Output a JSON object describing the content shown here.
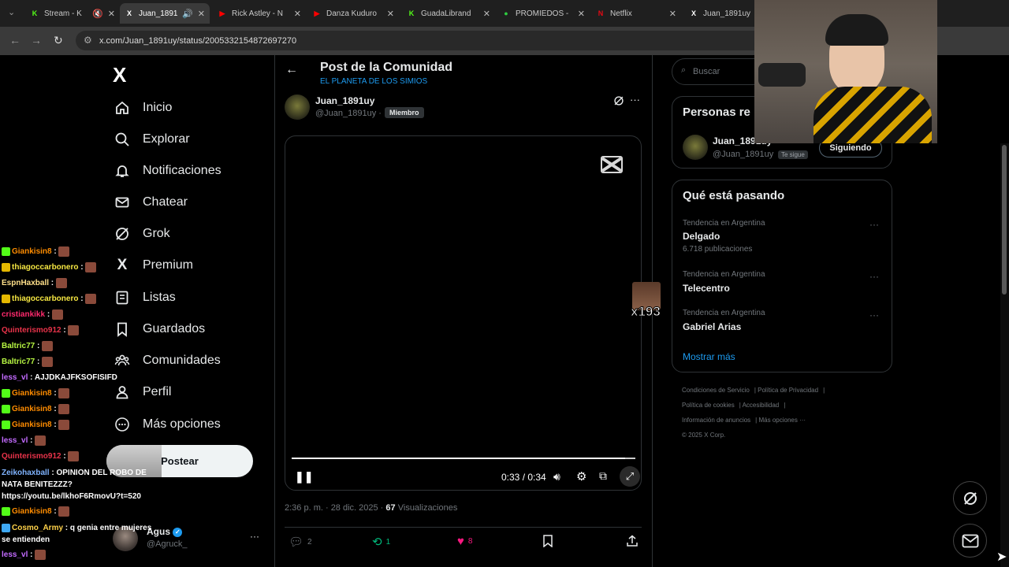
{
  "browser": {
    "tabs": [
      {
        "title": "Stream - K",
        "fav": "K",
        "favcolor": "#53fc18"
      },
      {
        "title": "Juan_1891",
        "fav": "X",
        "favcolor": "#ffffff"
      },
      {
        "title": "Rick Astley - N",
        "fav": "▶",
        "favcolor": "#ff0000"
      },
      {
        "title": "Danza Kuduro",
        "fav": "▶",
        "favcolor": "#ff0000"
      },
      {
        "title": "GuadaLibrand",
        "fav": "K",
        "favcolor": "#53fc18"
      },
      {
        "title": "PROMIEDOS -",
        "fav": "●",
        "favcolor": "#2ecc40"
      },
      {
        "title": "Netflix",
        "fav": "N",
        "favcolor": "#e50914"
      },
      {
        "title": "Juan_1891uy",
        "fav": "X",
        "favcolor": "#ffffff"
      }
    ],
    "url": "x.com/Juan_1891uy/status/2005332154872697270"
  },
  "sidebar": {
    "logo": "X",
    "items": [
      {
        "label": "Inicio"
      },
      {
        "label": "Explorar"
      },
      {
        "label": "Notificaciones"
      },
      {
        "label": "Chatear"
      },
      {
        "label": "Grok"
      },
      {
        "label": "Premium"
      },
      {
        "label": "Listas"
      },
      {
        "label": "Guardados"
      },
      {
        "label": "Comunidades"
      },
      {
        "label": "Perfil"
      },
      {
        "label": "Más opciones"
      }
    ],
    "post_label": "Postear",
    "account": {
      "name": "Agus",
      "handle": "@Agruck_",
      "more": "···"
    }
  },
  "chat": [
    {
      "user": "Giankisin8",
      "color": "#ff8c00",
      "text": " :",
      "emote": true,
      "badge": "#53fc18"
    },
    {
      "user": "thiagoccarbonero",
      "color": "#f5e642",
      "text": " :",
      "emote": true,
      "badge": "#e5b800"
    },
    {
      "user": "EspnHaxball",
      "color": "#ffe08a",
      "text": " :",
      "emote": true,
      "badge": ""
    },
    {
      "user": "thiagoccarbonero",
      "color": "#f5e642",
      "text": " :",
      "emote": true,
      "badge": "#e5b800"
    },
    {
      "user": "cristiankikk",
      "color": "#ff2a6d",
      "text": " :",
      "emote": true,
      "badge": ""
    },
    {
      "user": "Quinterismo912",
      "color": "#e8334a",
      "text": " :",
      "emote": true,
      "badge": ""
    },
    {
      "user": "Baltric77",
      "color": "#b6f542",
      "text": " :",
      "emote": true,
      "badge": ""
    },
    {
      "user": "Baltric77",
      "color": "#b6f542",
      "text": " :",
      "emote": true,
      "badge": ""
    },
    {
      "user": "less_vl",
      "color": "#c36bff",
      "text": " : AJJDKAJFKSOFISIFD",
      "emote": false,
      "badge": ""
    },
    {
      "user": "Giankisin8",
      "color": "#ff8c00",
      "text": " :",
      "emote": true,
      "badge": "#53fc18"
    },
    {
      "user": "Giankisin8",
      "color": "#ff8c00",
      "text": " :",
      "emote": true,
      "badge": "#53fc18"
    },
    {
      "user": "Giankisin8",
      "color": "#ff8c00",
      "text": " :",
      "emote": true,
      "badge": "#53fc18"
    },
    {
      "user": "less_vl",
      "color": "#c36bff",
      "text": " :",
      "emote": true,
      "badge": ""
    },
    {
      "user": "Quinterismo912",
      "color": "#e8334a",
      "text": " :",
      "emote": true,
      "badge": ""
    },
    {
      "user": "Zeikohaxball",
      "color": "#7fb3ff",
      "text": " : OPINION DEL ROBO DE NATA BENITEZZZ? https://youtu.be/lkhoF6RmovU?t=520",
      "emote": false,
      "badge": "",
      "wrap": true
    },
    {
      "user": "Giankisin8",
      "color": "#ff8c00",
      "text": " :",
      "emote": true,
      "badge": "#53fc18"
    },
    {
      "user": "Cosmo_Army",
      "color": "#ffd24a",
      "text": " : q genia entre mujeres se entienden",
      "emote": false,
      "badge": "#3fa9f5",
      "wrap": true
    },
    {
      "user": "less_vl",
      "color": "#c36bff",
      "text": " :",
      "emote": true,
      "badge": ""
    }
  ],
  "post": {
    "header_title": "Post de la Comunidad",
    "header_sub": "EL PLANETA DE LOS SIMIOS",
    "author_name": "Juan_1891uy",
    "author_handle": "@Juan_1891uy",
    "member_badge": "Miembro",
    "video_time": "0:33 / 0:34",
    "video_progress": 0.97,
    "timestamp": "2:36 p. m. · 28 dic. 2025 ·",
    "views_count": "67",
    "views_label": "Visualizaciones",
    "replies": "2",
    "reposts": "1",
    "likes": "8"
  },
  "overlay": {
    "counter": "x193"
  },
  "right": {
    "search_placeholder": "Buscar",
    "people_title": "Personas re",
    "person_name": "Juan_1891uy",
    "person_handle": "@Juan_1891uy",
    "person_tag": "Te sigue",
    "follow_label": "Siguiendo",
    "trends_title": "Qué está pasando",
    "trends": [
      {
        "cat": "Tendencia en Argentina",
        "name": "Delgado",
        "count": "6.718 publicaciones"
      },
      {
        "cat": "Tendencia en Argentina",
        "name": "Telecentro",
        "count": ""
      },
      {
        "cat": "Tendencia en Argentina",
        "name": "Gabriel Arias",
        "count": ""
      }
    ],
    "show_more": "Mostrar más",
    "footer": [
      "Condiciones de Servicio",
      "Política de Privacidad",
      "Política de cookies",
      "Accesibilidad",
      "Información de anuncios",
      "Más opciones ···",
      "© 2025 X Corp."
    ]
  }
}
